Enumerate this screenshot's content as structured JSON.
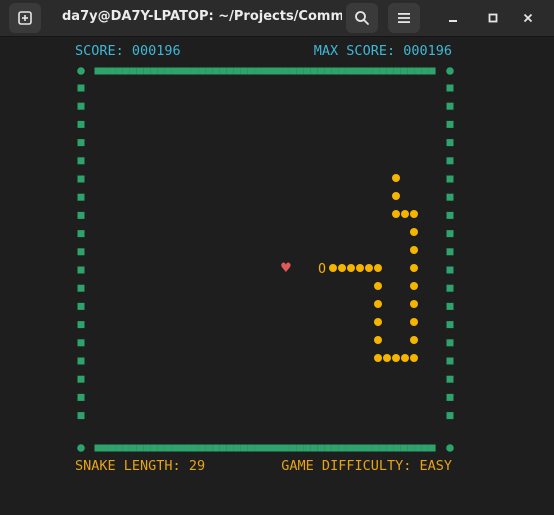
{
  "window": {
    "title": "da7y@DA7Y-LPATOP: ~/Projects/Comma..."
  },
  "toolbar": {
    "new_tab_icon": "new-tab-icon",
    "search_icon": "search-icon",
    "menu_icon": "hamburger-menu-icon",
    "minimize_icon": "minimize-icon",
    "maximize_icon": "maximize-icon",
    "close_icon": "close-icon"
  },
  "hud": {
    "score_label": "SCORE:",
    "score": "000196",
    "max_score_label": "MAX SCORE:",
    "max_score": "000196",
    "snake_length_label": "SNAKE LENGTH:",
    "snake_length": "29",
    "difficulty_label": "GAME DIFFICULTY:",
    "difficulty": "EASY"
  },
  "game": {
    "food_glyph": "♥",
    "head_glyph": "O",
    "colors": {
      "background": "#1e1e1e",
      "wall": "#2ea36b",
      "snake": "#f5b400",
      "food": "#e05a5a",
      "hud_top": "#3fb8d6",
      "hud_bottom": "#e8a317"
    }
  }
}
